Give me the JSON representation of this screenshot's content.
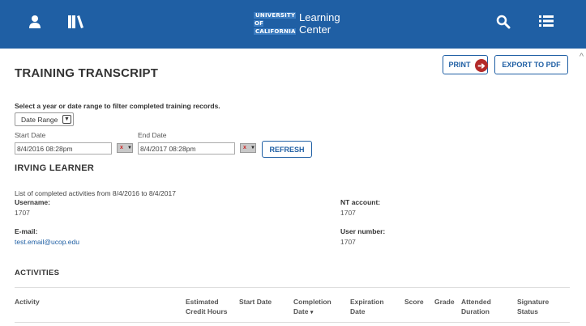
{
  "header": {
    "brand_line1": "UNIVERSITY",
    "brand_line2": "OF",
    "brand_line3": "CALIFORNIA",
    "brand_title_line1": "Learning",
    "brand_title_line2": "Center",
    "color": "#1f5fa4"
  },
  "page": {
    "title": "TRAINING TRANSCRIPT",
    "print_label": "PRINT",
    "export_label": "EXPORT TO PDF"
  },
  "filter": {
    "intro": "Select a year or date range to filter completed training records.",
    "range_value": "Date Range",
    "start_label": "Start Date",
    "start_value": "8/4/2016 08:28pm",
    "end_label": "End Date",
    "end_value": "8/4/2017 08:28pm",
    "refresh_label": "REFRESH"
  },
  "learner": {
    "name": "IRVING LEARNER",
    "list_note": "List of completed activities from  8/4/2016  to  8/4/2017",
    "username_label": "Username:",
    "username_value": "1707",
    "nt_label": "NT account:",
    "nt_value": "1707",
    "email_label": "E-mail:",
    "email_value": "test.email@ucop.edu",
    "user_number_label": "User number:",
    "user_number_value": "1707"
  },
  "activities": {
    "title": "ACTIVITIES",
    "columns": [
      {
        "line1": "Activity",
        "line2": ""
      },
      {
        "line1": "Estimated",
        "line2": "Credit Hours"
      },
      {
        "line1": "Start Date",
        "line2": ""
      },
      {
        "line1": "Completion",
        "line2": "Date"
      },
      {
        "line1": "Expiration",
        "line2": "Date"
      },
      {
        "line1": "Score",
        "line2": ""
      },
      {
        "line1": "Grade",
        "line2": ""
      },
      {
        "line1": "Attended",
        "line2": "Duration"
      },
      {
        "line1": "Signature",
        "line2": "Status"
      }
    ]
  }
}
